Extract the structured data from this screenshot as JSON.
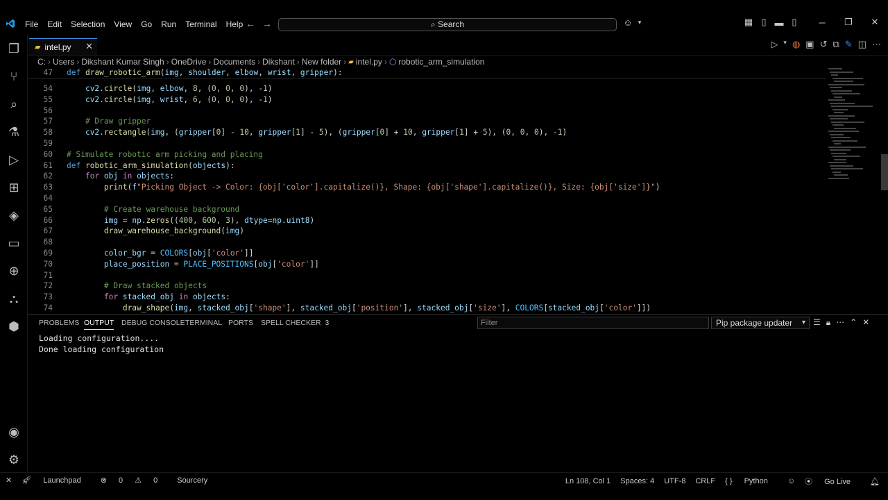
{
  "menu": [
    "File",
    "Edit",
    "Selection",
    "View",
    "Go",
    "Run",
    "Terminal",
    "Help"
  ],
  "search": {
    "label": "Search"
  },
  "tab": {
    "name": "intel.py"
  },
  "breadcrumb": [
    "C:",
    "Users",
    "Dikshant Kumar Singh",
    "OneDrive",
    "Documents",
    "Dikshant",
    "New folder",
    "intel.py",
    "robotic_arm_simulation"
  ],
  "editor": {
    "sticky": {
      "num": "47",
      "text": "def draw_robotic_arm(img, shoulder, elbow, wrist, gripper):"
    },
    "lines": [
      {
        "num": "54",
        "text": "    cv2.circle(img, elbow, 8, (0, 0, 0), -1)"
      },
      {
        "num": "55",
        "text": "    cv2.circle(img, wrist, 6, (0, 0, 0), -1)"
      },
      {
        "num": "56",
        "text": ""
      },
      {
        "num": "57",
        "text": "    # Draw gripper"
      },
      {
        "num": "58",
        "text": "    cv2.rectangle(img, (gripper[0] - 10, gripper[1] - 5), (gripper[0] + 10, gripper[1] + 5), (0, 0, 0), -1)"
      },
      {
        "num": "59",
        "text": ""
      },
      {
        "num": "60",
        "text": "# Simulate robotic arm picking and placing"
      },
      {
        "num": "61",
        "text": "def robotic_arm_simulation(objects):"
      },
      {
        "num": "62",
        "text": "    for obj in objects:"
      },
      {
        "num": "63",
        "text": "        print(f\"Picking Object -> Color: {obj['color'].capitalize()}, Shape: {obj['shape'].capitalize()}, Size: {obj['size']}\")"
      },
      {
        "num": "64",
        "text": ""
      },
      {
        "num": "65",
        "text": "        # Create warehouse background"
      },
      {
        "num": "66",
        "text": "        img = np.zeros((400, 600, 3), dtype=np.uint8)"
      },
      {
        "num": "67",
        "text": "        draw_warehouse_background(img)"
      },
      {
        "num": "68",
        "text": ""
      },
      {
        "num": "69",
        "text": "        color_bgr = COLORS[obj['color']]"
      },
      {
        "num": "70",
        "text": "        place_position = PLACE_POSITIONS[obj['color']]"
      },
      {
        "num": "71",
        "text": ""
      },
      {
        "num": "72",
        "text": "        # Draw stacked objects"
      },
      {
        "num": "73",
        "text": "        for stacked_obj in objects:"
      },
      {
        "num": "74",
        "text": "            draw_shape(img, stacked_obj['shape'], stacked_obj['position'], stacked_obj['size'], COLORS[stacked_obj['color']])"
      }
    ]
  },
  "panel": {
    "tabs": [
      "PROBLEMS",
      "OUTPUT",
      "DEBUG CONSOLE",
      "TERMINAL",
      "PORTS",
      "SPELL CHECKER"
    ],
    "spell_checker_count": "3",
    "filter_placeholder": "Filter",
    "channel": "Pip package updater",
    "output_lines": [
      "Loading configuration....",
      "Done loading configuration"
    ]
  },
  "status": {
    "launchpad": "Launchpad",
    "errors": "0",
    "warnings": "0",
    "sourcery": "Sourcery",
    "position": "Ln 108, Col 1",
    "spaces": "Spaces: 4",
    "encoding": "UTF-8",
    "eol": "CRLF",
    "language": "Python",
    "golive": "Go Live"
  },
  "colors": {
    "accent": "#3a8ee6",
    "keyword": "#569cd6",
    "function": "#dcdcaa",
    "string": "#ce9178",
    "comment": "#6a9955",
    "number": "#b5cea8"
  }
}
